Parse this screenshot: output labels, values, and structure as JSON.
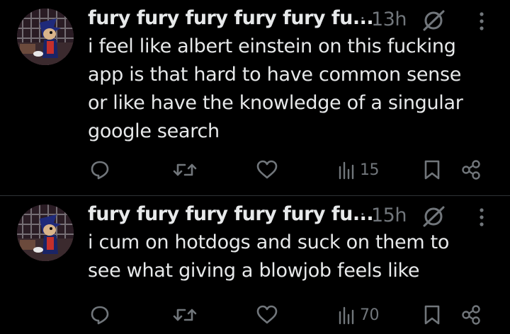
{
  "posts": [
    {
      "author": "fury fury fury fury fury fu...",
      "separator": "·",
      "time": "13h",
      "lines": [
        "i feel like albert einstein on this fucking",
        "app is that hard to have common sense",
        "or like have the knowledge of a singular",
        "google search"
      ],
      "views": "15"
    },
    {
      "author": "fury fury fury fury fury fu...",
      "separator": "·",
      "time": "15h",
      "lines": [
        "i cum on hotdogs and suck on them to",
        "see what giving a blowjob feels like"
      ],
      "views": "70"
    }
  ],
  "icons": {
    "reply": "reply-icon",
    "repost": "repost-icon",
    "like": "heart-icon",
    "views": "views-icon",
    "bookmark": "bookmark-icon",
    "share": "share-icon",
    "more": "more-options-icon",
    "header_mark": "slashed-circle-icon"
  },
  "colors": {
    "background": "#000000",
    "text": "#e7e9ea",
    "muted": "#71767b",
    "divider": "#2f3336"
  }
}
